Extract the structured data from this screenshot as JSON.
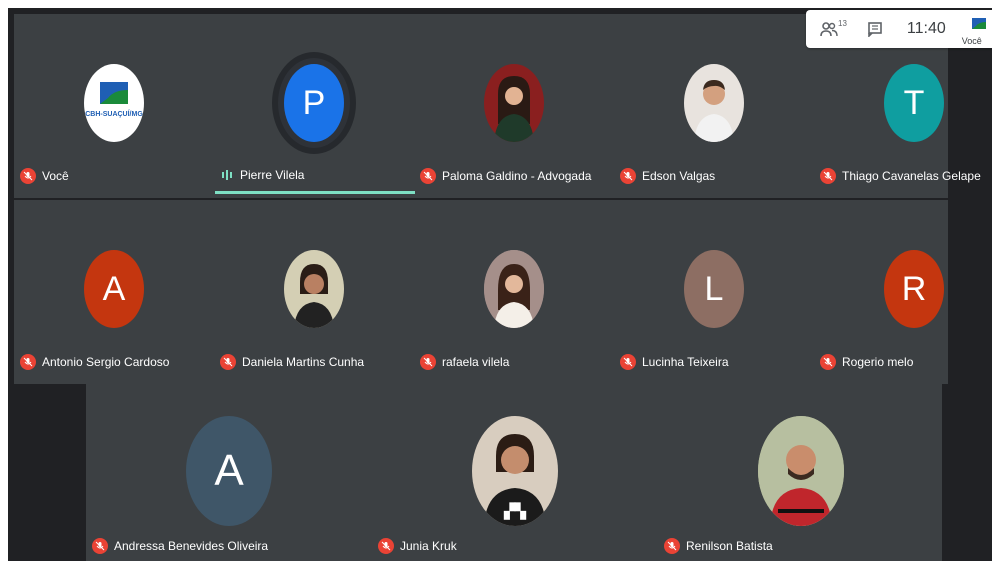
{
  "topbar": {
    "people_count": "13",
    "time": "11:40",
    "self_label": "Você"
  },
  "logo": {
    "text": "CBH-SUAÇUÍ/MG"
  },
  "participants": [
    {
      "name": "Você",
      "initial": "",
      "color": "#ffffff",
      "muted": true
    },
    {
      "name": "Pierre Vilela",
      "initial": "P",
      "color": "#1a73e8",
      "muted": false,
      "speaking": true
    },
    {
      "name": "Paloma Galdino - Advogada",
      "initial": "",
      "color": "#8a1f1f",
      "muted": true
    },
    {
      "name": "Edson Valgas",
      "initial": "",
      "color": "#d9cfc5",
      "muted": true
    },
    {
      "name": "Thiago Cavanelas Gelape",
      "initial": "T",
      "color": "#0f9ea0",
      "muted": true
    },
    {
      "name": "Antonio Sergio Cardoso",
      "initial": "A",
      "color": "#c4360f",
      "muted": true
    },
    {
      "name": "Daniela Martins Cunha",
      "initial": "",
      "color": "#c9c2a7",
      "muted": true
    },
    {
      "name": "rafaela vilela",
      "initial": "",
      "color": "#8c7f86",
      "muted": true
    },
    {
      "name": "Lucinha Teixeira",
      "initial": "L",
      "color": "#8d6e63",
      "muted": true
    },
    {
      "name": "Rogerio melo",
      "initial": "R",
      "color": "#c4360f",
      "muted": true
    },
    {
      "name": "Andressa Benevides Oliveira",
      "initial": "A",
      "color": "#3f5668",
      "muted": true
    },
    {
      "name": "Junia Kruk",
      "initial": "",
      "color": "#b9a99a",
      "muted": true
    },
    {
      "name": "Renilson Batista",
      "initial": "",
      "color": "#9aa37f",
      "muted": true
    }
  ]
}
